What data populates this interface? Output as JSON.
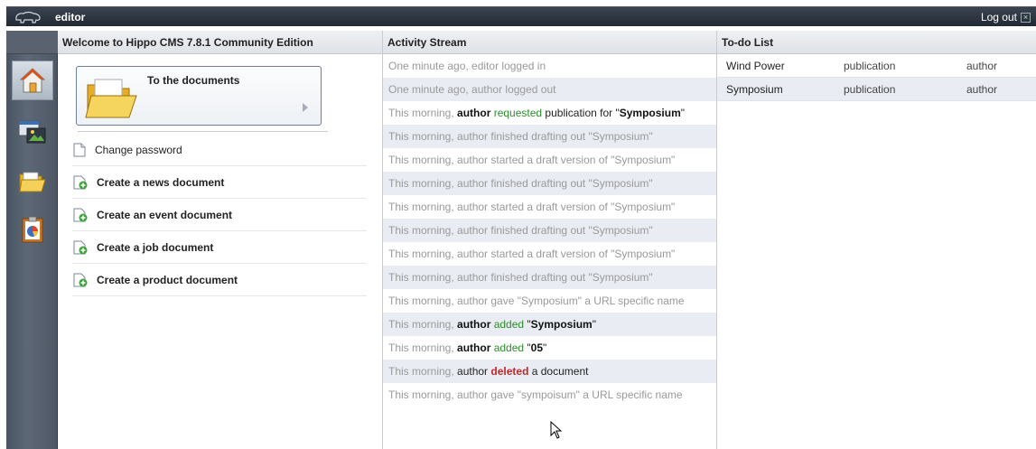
{
  "header": {
    "app_name": "editor",
    "logout_label": "Log out"
  },
  "sidebar": {
    "items": [
      {
        "name": "home",
        "icon": "home-icon"
      },
      {
        "name": "channel-manager",
        "icon": "channel-manager-icon"
      },
      {
        "name": "documents",
        "icon": "folder-icon"
      },
      {
        "name": "reports",
        "icon": "reports-icon"
      }
    ]
  },
  "welcome": {
    "title": "Welcome to Hippo CMS 7.8.1 Community Edition",
    "to_documents_label": "To the documents",
    "change_password": "Change password",
    "actions": [
      "Create a news document",
      "Create an event document",
      "Create a job document",
      "Create a product document"
    ]
  },
  "activity": {
    "title": "Activity Stream",
    "rows": [
      {
        "parts": [
          [
            "n",
            "One minute ago, editor logged in"
          ]
        ]
      },
      {
        "parts": [
          [
            "n",
            "One minute ago, author logged out"
          ]
        ]
      },
      {
        "parts": [
          [
            "n",
            "This morning, "
          ],
          [
            "b",
            "author"
          ],
          [
            "g",
            " requested"
          ],
          [
            "k",
            " publication for \""
          ],
          [
            "b",
            "Symposium"
          ],
          [
            "k",
            "\""
          ]
        ]
      },
      {
        "parts": [
          [
            "n",
            "This morning, author finished drafting out \"Symposium\""
          ]
        ]
      },
      {
        "parts": [
          [
            "n",
            "This morning, author started a draft version of \"Symposium\""
          ]
        ]
      },
      {
        "parts": [
          [
            "n",
            "This morning, author finished drafting out \"Symposium\""
          ]
        ]
      },
      {
        "parts": [
          [
            "n",
            "This morning, author started a draft version of \"Symposium\""
          ]
        ]
      },
      {
        "parts": [
          [
            "n",
            "This morning, author finished drafting out \"Symposium\""
          ]
        ]
      },
      {
        "parts": [
          [
            "n",
            "This morning, author started a draft version of \"Symposium\""
          ]
        ]
      },
      {
        "parts": [
          [
            "n",
            "This morning, author finished drafting out \"Symposium\""
          ]
        ]
      },
      {
        "parts": [
          [
            "n",
            "This morning, author gave \"Symposium\" a URL specific name"
          ]
        ]
      },
      {
        "parts": [
          [
            "n",
            "This morning, "
          ],
          [
            "b",
            "author"
          ],
          [
            "g",
            " added"
          ],
          [
            "k",
            " \""
          ],
          [
            "b",
            "Symposium"
          ],
          [
            "k",
            "\""
          ]
        ]
      },
      {
        "parts": [
          [
            "n",
            "This morning, "
          ],
          [
            "b",
            "author"
          ],
          [
            "g",
            " added"
          ],
          [
            "k",
            " \""
          ],
          [
            "b",
            "05"
          ],
          [
            "k",
            "\""
          ]
        ]
      },
      {
        "parts": [
          [
            "n",
            "This morning, "
          ],
          [
            "k",
            "author "
          ],
          [
            "r",
            "deleted"
          ],
          [
            "k",
            " a document"
          ]
        ]
      },
      {
        "parts": [
          [
            "n",
            "This morning, author gave \"sympoisum\" a URL specific name"
          ]
        ]
      }
    ]
  },
  "todo": {
    "title": "To-do List",
    "rows": [
      {
        "name": "Wind Power",
        "type": "publication",
        "by": "author"
      },
      {
        "name": "Symposium",
        "type": "publication",
        "by": "author"
      }
    ]
  }
}
